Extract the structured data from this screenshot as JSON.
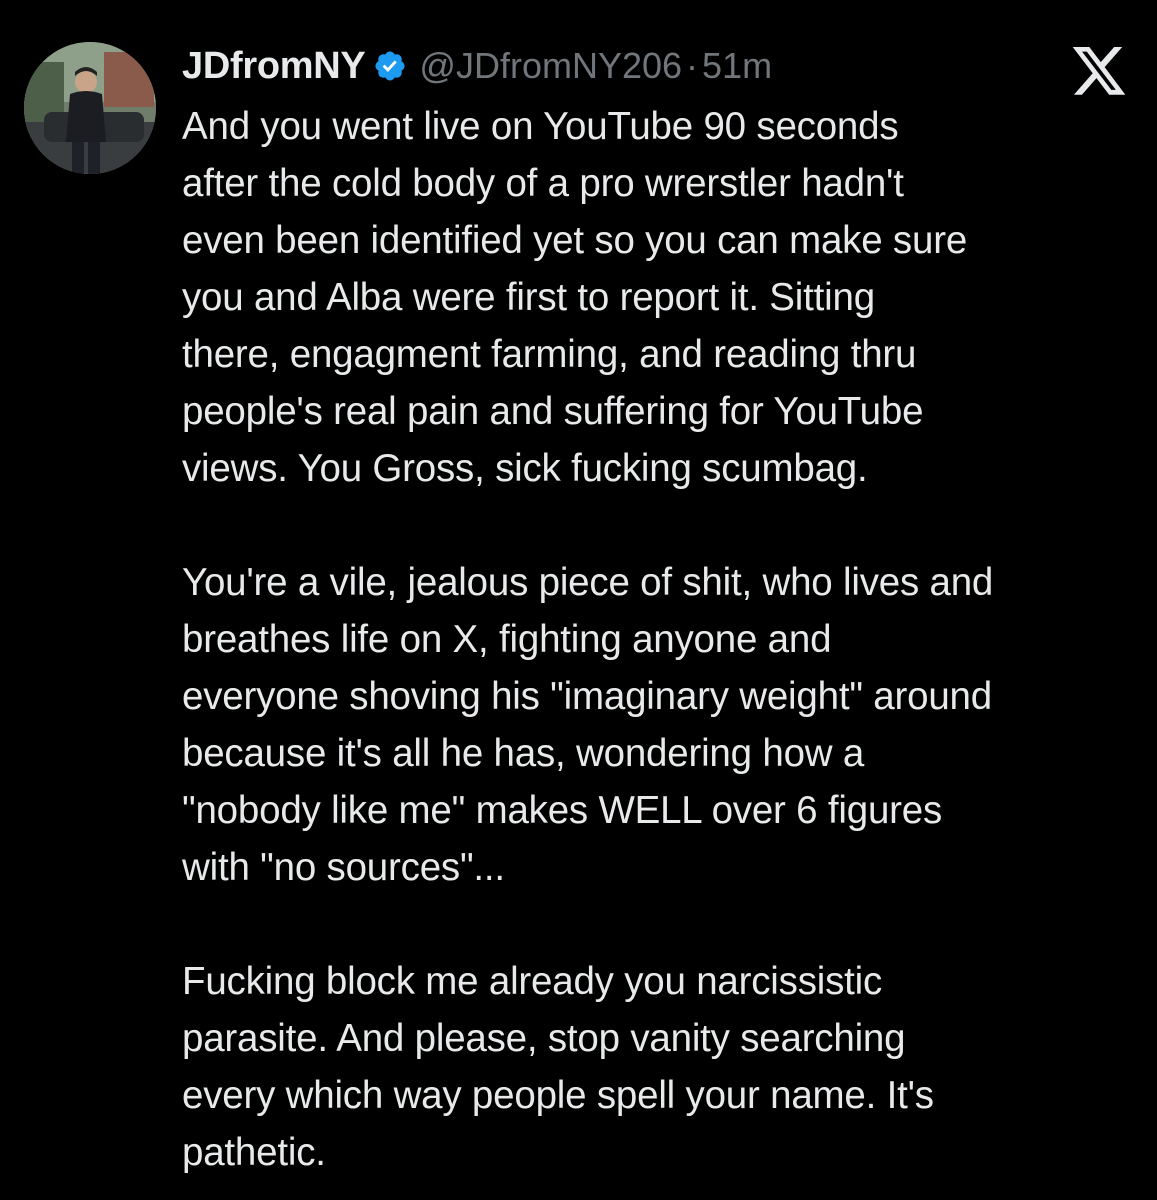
{
  "tweet": {
    "author": {
      "display_name": "JDfromNY",
      "handle": "@JDfromNY206",
      "verified": true,
      "avatar_icon": "avatar-image"
    },
    "separator": "·",
    "timestamp": "51m",
    "brand_icon": "x-logo-icon",
    "paragraphs": [
      "And you went live on YouTube 90 seconds\nafter the cold body of a pro wrerstler hadn't\neven been identified yet so you can make sure\nyou and Alba were first to report it. Sitting\nthere, engagment farming, and reading thru\npeople's real pain and suffering for YouTube\nviews. You Gross, sick fucking scumbag.",
      "You're a vile, jealous piece of shit, who lives and\nbreathes life on X, fighting anyone and\neveryone shoving his \"imaginary weight\" around\nbecause it's all he has, wondering how a\n\"nobody like me\" makes WELL over 6 figures\nwith \"no sources\"...",
      "Fucking block me already you narcissistic\nparasite. And please, stop vanity searching\nevery which way people spell your name. It's\npathetic."
    ]
  },
  "colors": {
    "background": "#000000",
    "text_primary": "#e7e9ea",
    "text_secondary": "#71767b",
    "verified_badge": "#1d9bf0"
  }
}
